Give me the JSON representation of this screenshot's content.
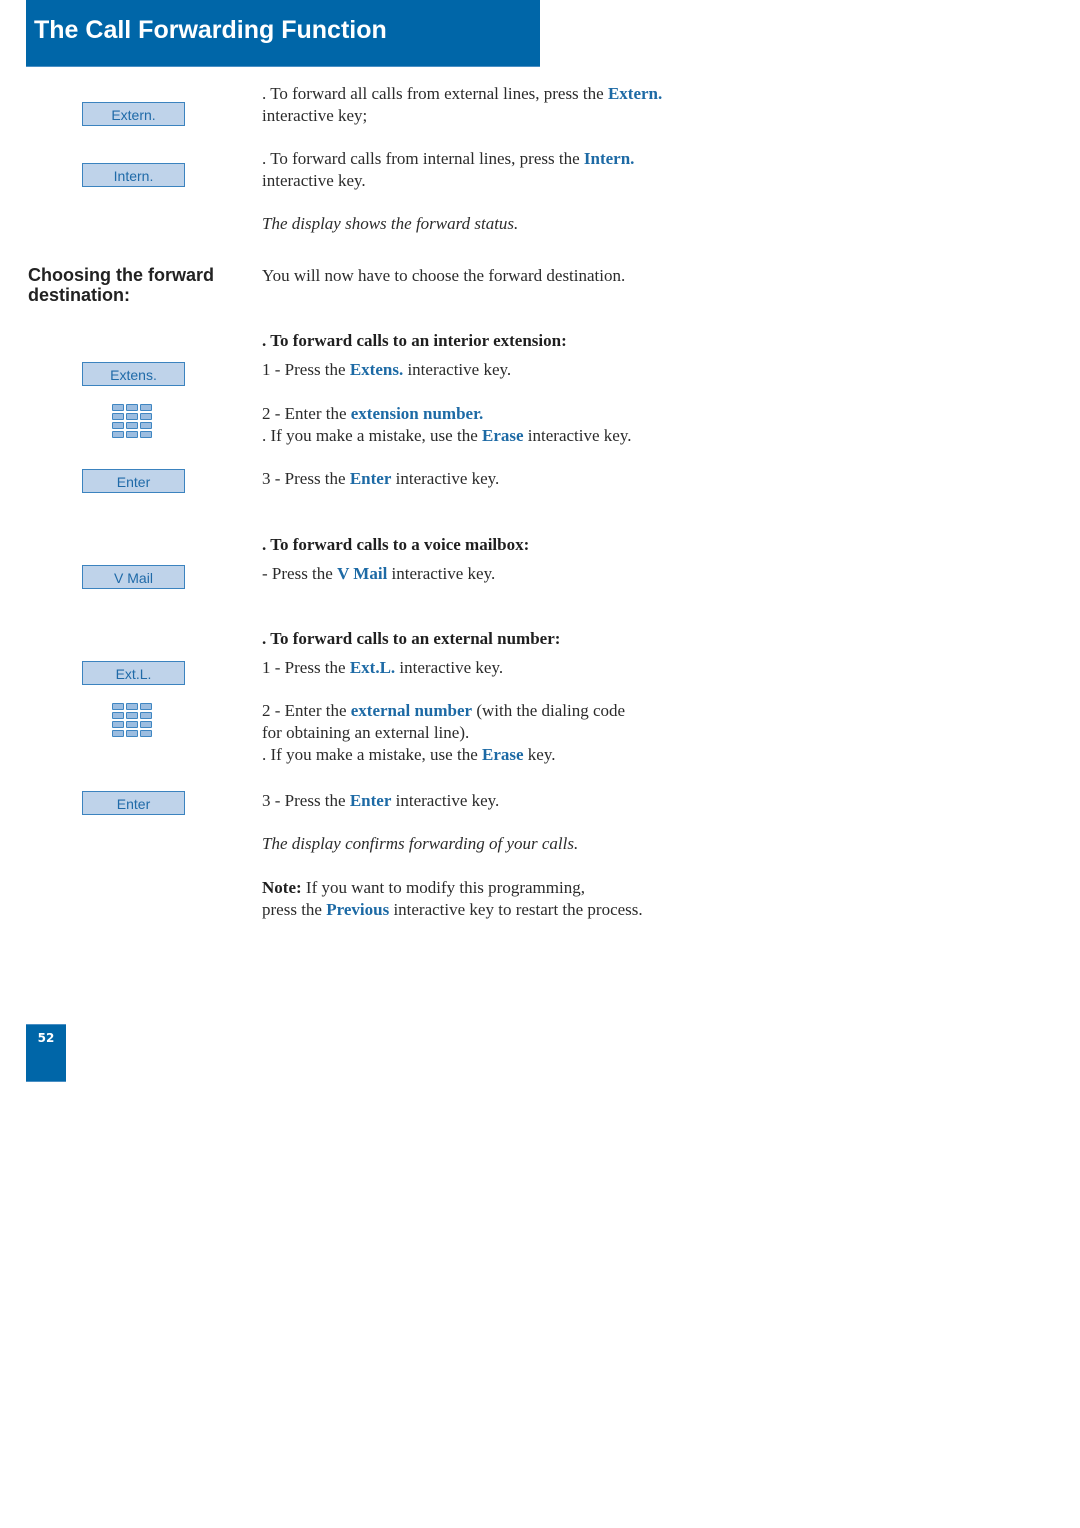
{
  "header": {
    "title": "The Call Forwarding Function"
  },
  "colors": {
    "brand": "#0066a8",
    "key_fill": "#bfd3ea",
    "key_text": "#1f6aa8",
    "highlight": "#1d6aa5"
  },
  "keys": {
    "extern": "Extern.",
    "intern": "Intern.",
    "extens": "Extens.",
    "enter_1": "Enter",
    "vmail": "V Mail",
    "extl": "Ext.L.",
    "enter_2": "Enter"
  },
  "icons": {
    "keypad": "keypad-icon"
  },
  "side_heading": "Choosing the forward destination:",
  "intro": {
    "extern": {
      "pre": ". To forward all calls from external lines, press the ",
      "key": "Extern.",
      "post": "interactive key;"
    },
    "intern": {
      "pre": ". To forward calls from internal lines, press the ",
      "key": "Intern.",
      "post": "interactive key."
    },
    "status_note": "The display shows the forward status."
  },
  "choose_text": "You will now have to choose the forward destination.",
  "interior": {
    "heading": ". To forward calls to an interior extension:",
    "step1": {
      "pre": "1 - Press the ",
      "key": "Extens.",
      "post": " interactive key."
    },
    "step2": {
      "pre": "2 - Enter the ",
      "key": "extension number."
    },
    "mistake": {
      "pre": ". If you make a mistake, use the ",
      "key": "Erase",
      "post": " interactive key."
    },
    "step3": {
      "pre": "3 - Press the ",
      "key": "Enter",
      "post": " interactive key."
    }
  },
  "mailbox": {
    "heading": ". To forward calls to a voice mailbox:",
    "step": {
      "pre": "- Press the ",
      "key": "V Mail",
      "post": " interactive key."
    }
  },
  "external": {
    "heading": ". To forward calls to an external number:",
    "step1": {
      "pre": "1 - Press the ",
      "key": "Ext.L.",
      "post": " interactive key."
    },
    "step2": {
      "pre": "2 - Enter the ",
      "key": "external number",
      "post": " (with the dialing code",
      "line2": "for obtaining an external line)."
    },
    "mistake": {
      "pre": ". If you make a mistake, use the ",
      "key": "Erase",
      "post": " key."
    },
    "step3": {
      "pre": "3 - Press the ",
      "key": "Enter",
      "post": " interactive key."
    },
    "confirm_note": "The display confirms forwarding of your calls."
  },
  "note": {
    "label": "Note:",
    "line1": " If you want to modify this programming,",
    "pre": "press the ",
    "key": "Previous",
    "post": " interactive key to restart the process."
  },
  "page_number": "52"
}
